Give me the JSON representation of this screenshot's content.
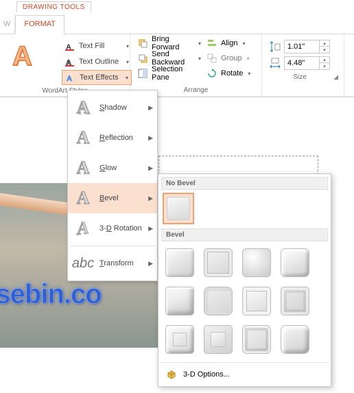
{
  "tabs": {
    "context_title": "DRAWING TOOLS",
    "ghost": "W",
    "format": "FORMAT"
  },
  "wordart": {
    "group_label": "WordArt Styles",
    "text_fill": "Text Fill",
    "text_outline": "Text Outline",
    "text_effects": "Text Effects"
  },
  "arrange": {
    "group_label": "Arrange",
    "bring_forward": "Bring Forward",
    "send_backward": "Send Backward",
    "selection_pane": "Selection Pane",
    "align": "Align",
    "group": "Group",
    "rotate": "Rotate"
  },
  "size": {
    "group_label": "Size",
    "height": "1.01\"",
    "width": "4.48\""
  },
  "fx": {
    "shadow": "Shadow",
    "reflection": "Reflection",
    "glow": "Glow",
    "bevel": "Bevel",
    "rotation3d": "3-D Rotation",
    "transform": "Transform"
  },
  "bevel": {
    "no_bevel": "No Bevel",
    "bevel": "Bevel",
    "options": "3-D Options..."
  },
  "canvas": {
    "sample_text": "nsebin.co"
  }
}
